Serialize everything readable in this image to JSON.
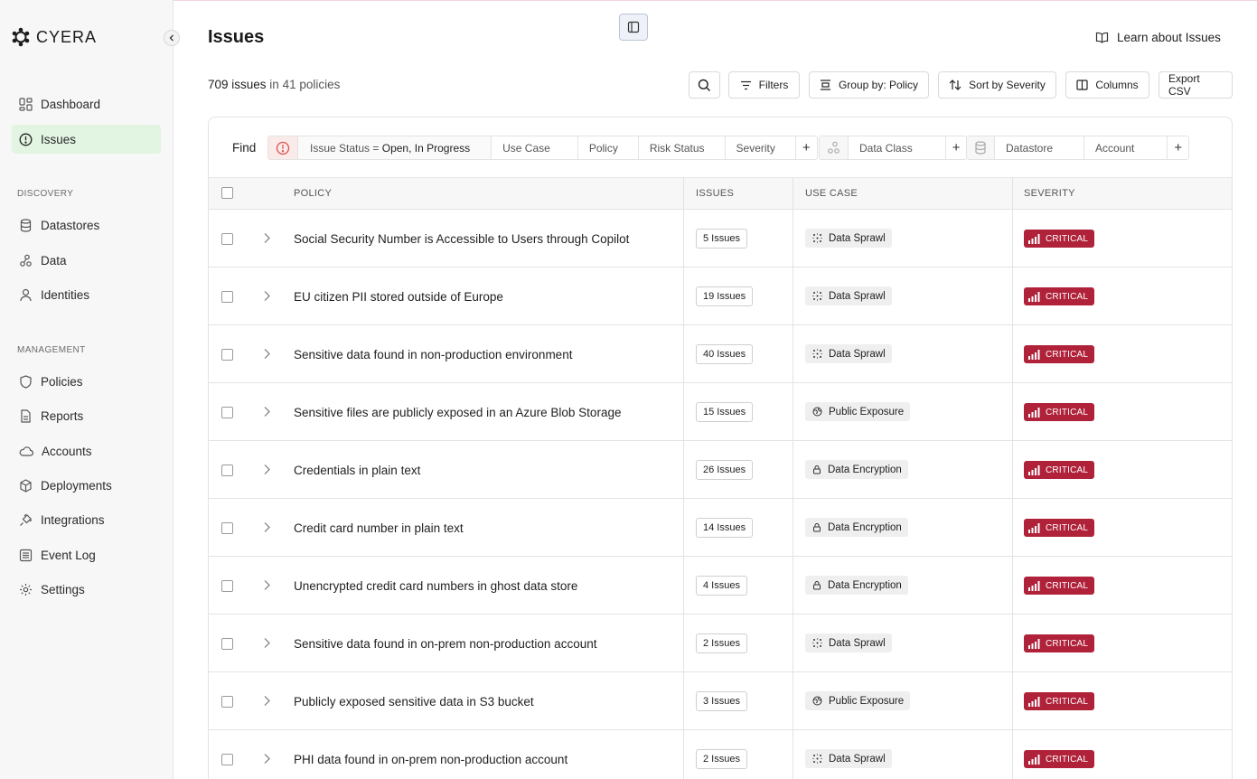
{
  "sidebar": {
    "logo": "CYERA",
    "items_top": [
      {
        "label": "Dashboard",
        "icon": "dashboard-icon"
      },
      {
        "label": "Issues",
        "icon": "alert-circle-icon",
        "active": true
      }
    ],
    "discovery_label": "DISCOVERY",
    "discovery": [
      {
        "label": "Datastores",
        "icon": "database-icon"
      },
      {
        "label": "Data",
        "icon": "data-nodes-icon"
      },
      {
        "label": "Identities",
        "icon": "user-icon"
      }
    ],
    "management_label": "MANAGEMENT",
    "management": [
      {
        "label": "Policies",
        "icon": "shield-icon"
      },
      {
        "label": "Reports",
        "icon": "report-icon"
      },
      {
        "label": "Accounts",
        "icon": "cloud-icon"
      },
      {
        "label": "Deployments",
        "icon": "cube-icon"
      },
      {
        "label": "Integrations",
        "icon": "plug-icon"
      },
      {
        "label": "Event Log",
        "icon": "list-icon"
      },
      {
        "label": "Settings",
        "icon": "gear-icon"
      }
    ]
  },
  "header": {
    "title": "Issues",
    "learn_link": "Learn about Issues"
  },
  "summary": {
    "issue_count": "709 issues",
    "in_text": " in ",
    "policy_count": "41 policies"
  },
  "toolbar": {
    "filters": "Filters",
    "group_by": "Group by: Policy",
    "sort_by": "Sort by Severity",
    "columns": "Columns",
    "export": "Export CSV"
  },
  "find": {
    "label": "Find",
    "status_filter_key": "Issue Status",
    "status_filter_op": " = ",
    "status_filter_value": "Open, In Progress",
    "group1": [
      "Use Case",
      "Policy",
      "Risk Status",
      "Severity"
    ],
    "group2": [
      "Data Class"
    ],
    "group3": [
      "Datastore",
      "Account"
    ]
  },
  "table": {
    "headers": {
      "policy": "POLICY",
      "issues": "ISSUES",
      "use_case": "USE CASE",
      "severity": "SEVERITY"
    },
    "rows": [
      {
        "policy": "Social Security Number is Accessible to Users through Copilot",
        "issues": "5 Issues",
        "use_case": "Data Sprawl",
        "use_case_icon": "sprawl-icon",
        "severity": "CRITICAL"
      },
      {
        "policy": "EU citizen PII stored outside of Europe",
        "issues": "19 Issues",
        "use_case": "Data Sprawl",
        "use_case_icon": "sprawl-icon",
        "severity": "CRITICAL"
      },
      {
        "policy": "Sensitive data found in non-production environment",
        "issues": "40 Issues",
        "use_case": "Data Sprawl",
        "use_case_icon": "sprawl-icon",
        "severity": "CRITICAL"
      },
      {
        "policy": "Sensitive files are publicly exposed in an Azure Blob Storage",
        "issues": "15 Issues",
        "use_case": "Public Exposure",
        "use_case_icon": "globe-icon",
        "severity": "CRITICAL"
      },
      {
        "policy": "Credentials in plain text",
        "issues": "26 Issues",
        "use_case": "Data Encryption",
        "use_case_icon": "lock-icon",
        "severity": "CRITICAL"
      },
      {
        "policy": "Credit card number in plain text",
        "issues": "14 Issues",
        "use_case": "Data Encryption",
        "use_case_icon": "lock-icon",
        "severity": "CRITICAL"
      },
      {
        "policy": "Unencrypted credit card numbers in ghost data store",
        "issues": "4 Issues",
        "use_case": "Data Encryption",
        "use_case_icon": "lock-icon",
        "severity": "CRITICAL"
      },
      {
        "policy": "Sensitive data found in on-prem non-production account",
        "issues": "2 Issues",
        "use_case": "Data Sprawl",
        "use_case_icon": "sprawl-icon",
        "severity": "CRITICAL"
      },
      {
        "policy": "Publicly exposed sensitive data in S3 bucket",
        "issues": "3 Issues",
        "use_case": "Public Exposure",
        "use_case_icon": "globe-icon",
        "severity": "CRITICAL"
      },
      {
        "policy": "PHI data found in on-prem non-production account",
        "issues": "2 Issues",
        "use_case": "Data Sprawl",
        "use_case_icon": "sprawl-icon",
        "severity": "CRITICAL"
      }
    ]
  },
  "colors": {
    "active_nav": "#e2f4e2",
    "critical": "#b0223a",
    "alert_red": "#d9534f"
  }
}
